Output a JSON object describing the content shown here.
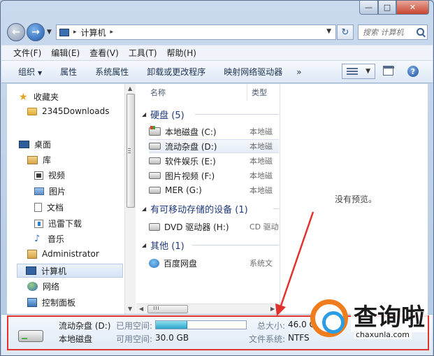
{
  "window": {
    "controls": {
      "minimize": "—",
      "maximize": "□",
      "close": "✕"
    }
  },
  "nav": {
    "back_icon": "arrow-left",
    "forward_icon": "arrow-right",
    "breadcrumb": {
      "root_sep": "▸",
      "location": "计算机",
      "trail_sep": "▸"
    },
    "search_placeholder": "搜索 计算机"
  },
  "menubar": [
    "文件(F)",
    "编辑(E)",
    "查看(V)",
    "工具(T)",
    "帮助(H)"
  ],
  "toolbar": {
    "organize": "组织",
    "items": [
      "属性",
      "系统属性",
      "卸载或更改程序",
      "映射网络驱动器"
    ],
    "more": "»"
  },
  "sidebar": {
    "items": [
      {
        "label": "收藏夹",
        "icon": "star-icon"
      },
      {
        "label": "2345Downloads",
        "icon": "folder-icon"
      },
      {
        "label": "桌面",
        "icon": "desktop-icon"
      },
      {
        "label": "库",
        "icon": "library-icon"
      },
      {
        "label": "视频",
        "icon": "video-icon"
      },
      {
        "label": "图片",
        "icon": "picture-icon"
      },
      {
        "label": "文档",
        "icon": "document-icon"
      },
      {
        "label": "迅雷下载",
        "icon": "download-icon"
      },
      {
        "label": "音乐",
        "icon": "music-icon"
      },
      {
        "label": "Administrator",
        "icon": "user-folder-icon"
      },
      {
        "label": "计算机",
        "icon": "computer-icon"
      },
      {
        "label": "网络",
        "icon": "network-icon"
      },
      {
        "label": "控制面板",
        "icon": "control-panel-icon"
      }
    ]
  },
  "file_list": {
    "columns": {
      "name": "名称",
      "type": "类型"
    },
    "groups": [
      {
        "title": "硬盘 (5)"
      },
      {
        "title": "有可移动存储的设备 (1)"
      },
      {
        "title": "其他 (1)"
      }
    ],
    "files": [
      {
        "name": "本地磁盘 (C:)",
        "type": "本地磁"
      },
      {
        "name": "流动杂盘 (D:)",
        "type": "本地磁"
      },
      {
        "name": "软件娱乐 (E:)",
        "type": "本地磁"
      },
      {
        "name": "图片视频 (F:)",
        "type": "本地磁"
      },
      {
        "name": "MER (G:)",
        "type": "本地磁"
      },
      {
        "name": "DVD 驱动器 (H:)",
        "type": "CD 驱动"
      },
      {
        "name": "百度网盘",
        "type": "系统文"
      }
    ]
  },
  "preview": {
    "text": "没有预览。"
  },
  "details": {
    "drive_name": "流动杂盘 (D:)",
    "drive_type": "本地磁盘",
    "used_label": "已用空间:",
    "free_label": "可用空间:",
    "free_value": "30.0 GB",
    "total_label": "总大小:",
    "total_value": "46.0 G",
    "fs_label": "文件系统:",
    "fs_value": "NTFS",
    "used_fraction": 0.35
  },
  "watermark": {
    "logo_text": "查询啦",
    "url": "chaxunla.com"
  },
  "colors": {
    "annotation": "#e2322e",
    "usage_bar": "#2aa4c8"
  }
}
